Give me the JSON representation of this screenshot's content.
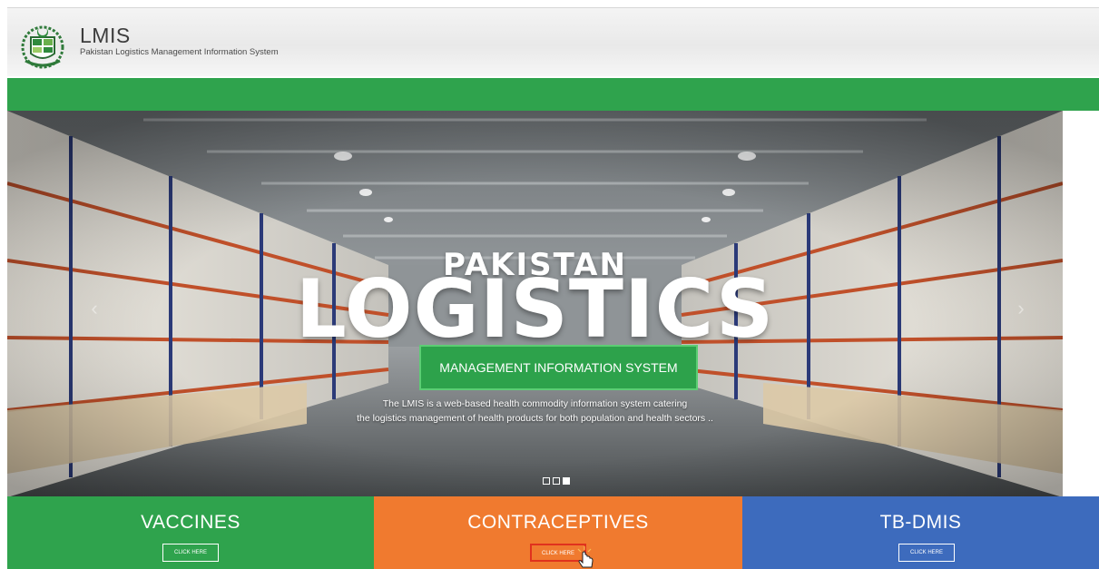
{
  "header": {
    "title": "LMIS",
    "subtitle": "Pakistan Logistics Management Information System",
    "logo_icon": "pakistan-emblem-icon"
  },
  "hero": {
    "kicker": "PAKISTAN",
    "title": "LOGISTICS",
    "cta_label": "MANAGEMENT INFORMATION SYSTEM",
    "description_line1": "The LMIS is a web-based health commodity information system catering",
    "description_line2": "the logistics management of health products for both population and health sectors ..",
    "slide_count": 3,
    "active_slide": 3,
    "background": "warehouse-photo"
  },
  "tiles": [
    {
      "title": "VACCINES",
      "button": "CLICK HERE",
      "color": "#2fa34d"
    },
    {
      "title": "CONTRACEPTIVES",
      "button": "CLICK HERE",
      "color": "#f07a2f"
    },
    {
      "title": "TB-DMIS",
      "button": "CLICK HERE",
      "color": "#3d6bbd"
    }
  ],
  "colors": {
    "brand_green": "#2fa34d",
    "orange": "#f07a2f",
    "blue": "#3d6bbd"
  }
}
